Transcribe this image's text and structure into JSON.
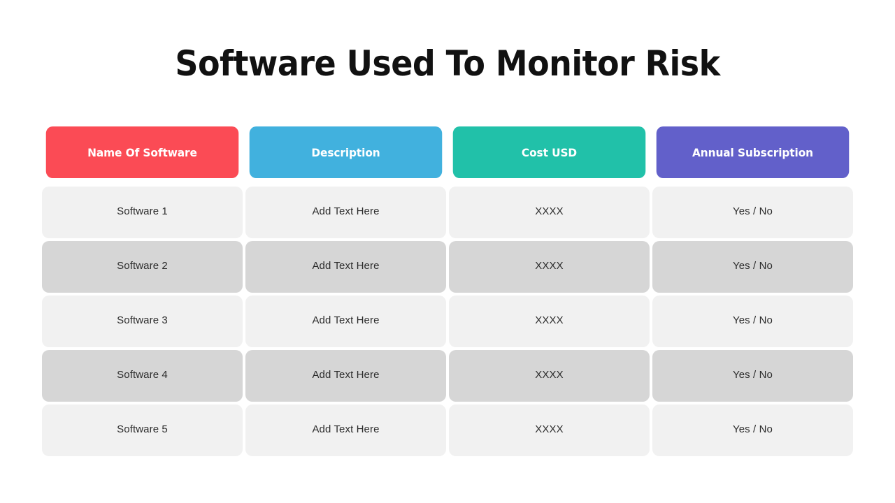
{
  "slide": {
    "title": "Software Used To Monitor Risk",
    "background": "#ffffff"
  },
  "table": {
    "headers": [
      {
        "label": "Name Of Software",
        "color": "#fb4b55"
      },
      {
        "label": "Description",
        "color": "#41b1de"
      },
      {
        "label": "Cost USD",
        "color": "#21c1a9"
      },
      {
        "label": "Annual Subscription",
        "color": "#6260ca"
      }
    ],
    "row_colors": {
      "light": "#f1f1f1",
      "dark": "#d6d6d6"
    },
    "rows": [
      {
        "shade": "light",
        "cells": [
          "Software 1",
          "Add Text Here",
          "XXXX",
          "Yes / No"
        ]
      },
      {
        "shade": "dark",
        "cells": [
          "Software 2",
          "Add Text Here",
          "XXXX",
          "Yes / No"
        ]
      },
      {
        "shade": "light",
        "cells": [
          "Software 3",
          "Add Text Here",
          "XXXX",
          "Yes / No"
        ]
      },
      {
        "shade": "dark",
        "cells": [
          "Software 4",
          "Add Text Here",
          "XXXX",
          "Yes / No"
        ]
      },
      {
        "shade": "light",
        "cells": [
          "Software 5",
          "Add Text Here",
          "XXXX",
          "Yes / No"
        ]
      }
    ]
  }
}
